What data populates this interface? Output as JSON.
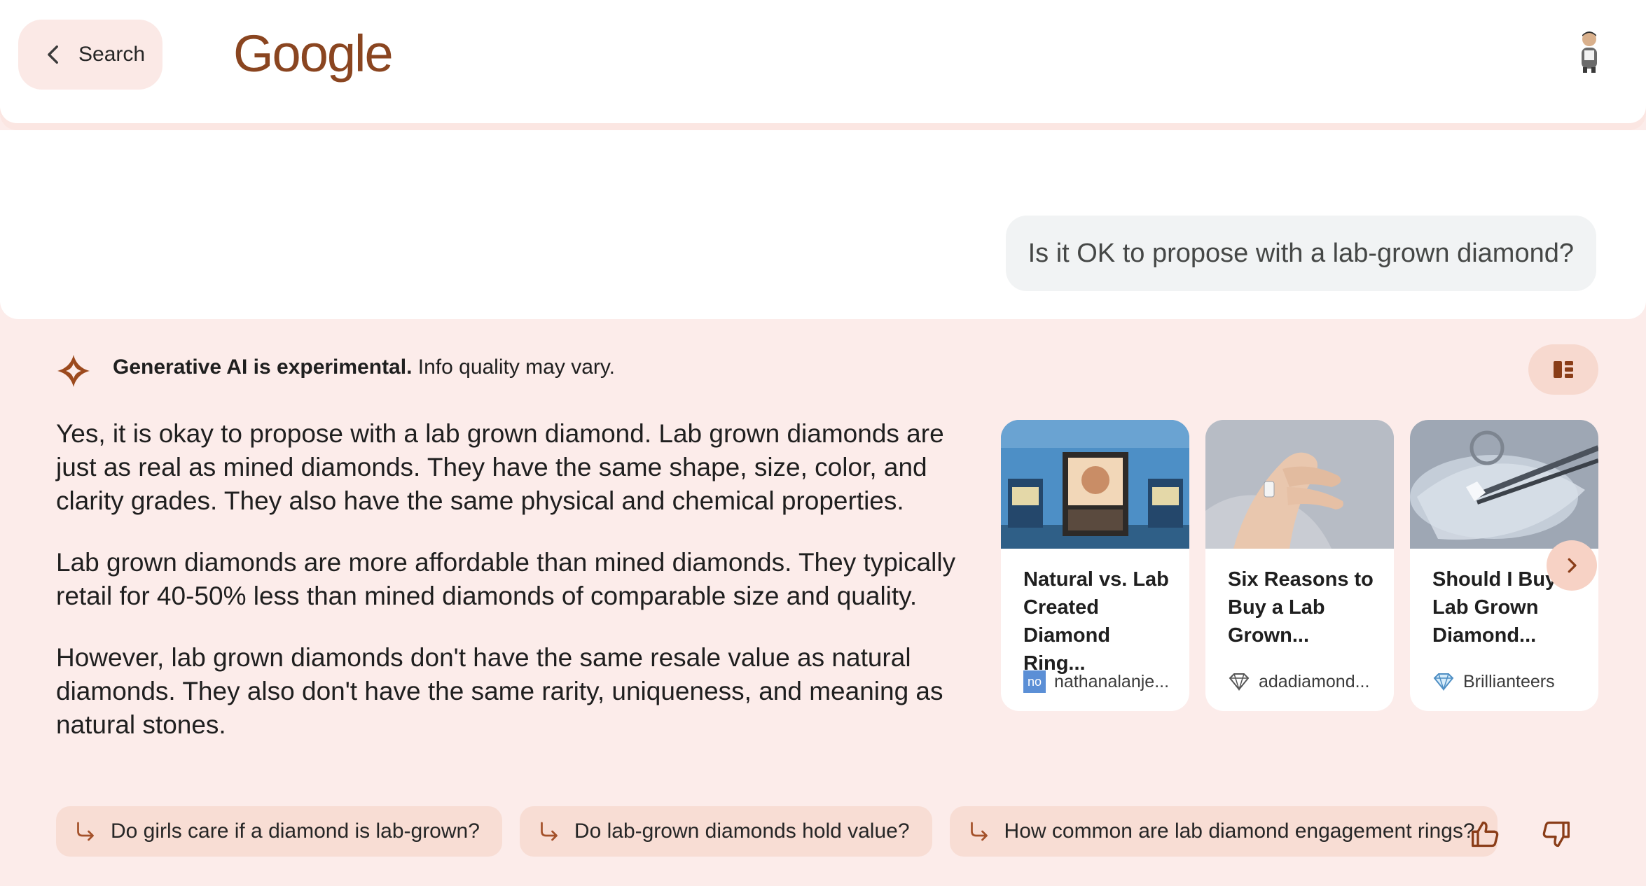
{
  "header": {
    "back_label": "Search",
    "logo_text": "Google"
  },
  "query": {
    "text": "Is it OK to propose with a lab-grown diamond?"
  },
  "ai_notice": {
    "bold": "Generative AI is experimental.",
    "rest": " Info quality may vary."
  },
  "answer": {
    "paragraphs": [
      "Yes, it is okay to propose with a lab grown diamond. Lab grown diamonds are just as real as mined diamonds. They have the same shape, size, color, and clarity grades. They also have the same physical and chemical properties.",
      "Lab grown diamonds are more affordable than mined diamonds. They typically retail for 40-50% less than mined diamonds of comparable size and quality.",
      "However, lab grown diamonds don't have the same resale value as natural diamonds. They also don't have the same rarity, uniqueness, and meaning as natural stones."
    ]
  },
  "cards": [
    {
      "title": "Natural vs. Lab Created Diamond Ring...",
      "source": "nathanalanje...",
      "favicon_text": "no",
      "image": "jewelry-store-window"
    },
    {
      "title": "Six Reasons to Buy a Lab Grown...",
      "source": "adadiamond...",
      "favicon": "diamond-icon",
      "image": "hand-with-ring"
    },
    {
      "title": "Should I Buy a Lab Grown Diamond...",
      "source": "Brillianteers",
      "favicon": "diamond-icon",
      "image": "diamond-in-tweezers"
    }
  ],
  "followups": [
    "Do girls care if a diamond is lab-grown?",
    "Do lab-grown diamonds hold value?",
    "How common are lab diamond engagement rings?"
  ],
  "colors": {
    "page_bg": "#fcecea",
    "accent": "#9c4a1e",
    "chip_bg": "#f8ddd4",
    "query_bubble": "#f1f3f4"
  },
  "icons": {
    "back": "chevron-left-icon",
    "ai": "sparkle-icon",
    "layout": "layout-list-icon",
    "next": "chevron-right-icon",
    "followup": "arrow-return-icon",
    "feedback_up": "thumbs-up-icon",
    "feedback_down": "thumbs-down-icon"
  }
}
